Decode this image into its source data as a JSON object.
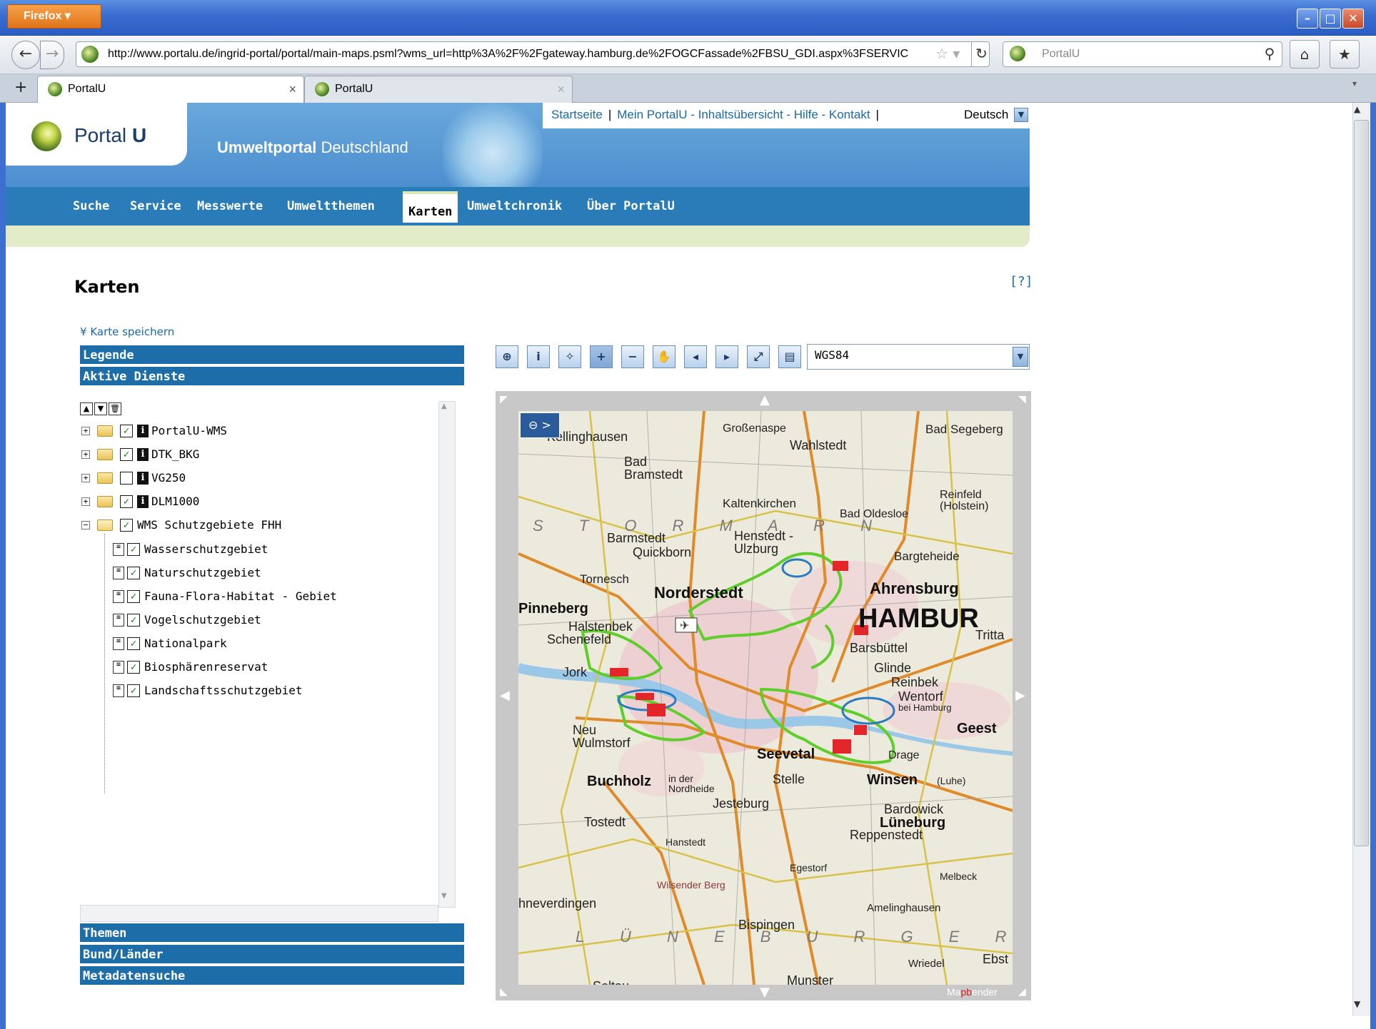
{
  "browser": {
    "menu_button": "Firefox",
    "url": "http://www.portalu.de/ingrid-portal/portal/main-maps.psml?wms_url=http%3A%2F%2Fgateway.hamburg.de%2FOGCFassade%2FBSU_GDI.aspx%3FSERVIC",
    "search_placeholder": "PortalU",
    "tabs": [
      {
        "label": "PortalU",
        "active": true
      },
      {
        "label": "PortalU",
        "active": false
      }
    ]
  },
  "header": {
    "logo_text_light": "Portal",
    "logo_text_bold": "U",
    "tagline_bold": "Umweltportal",
    "tagline_light": "Deutschland",
    "top_links": [
      "Startseite",
      "Mein PortalU - Inhaltsübersicht - Hilfe - Kontakt"
    ],
    "language": "Deutsch"
  },
  "mainnav": {
    "items": [
      "Suche",
      "Service",
      "Messwerte",
      "Umweltthemen",
      "Karten",
      "Umweltchronik",
      "Über PortalU"
    ],
    "active": "Karten"
  },
  "page": {
    "title": "Karten",
    "help": "[?]",
    "save_link": "Karte speichern"
  },
  "sidebar": {
    "legende": "Legende",
    "aktive_dienste": "Aktive Dienste",
    "themen": "Themen",
    "bund_laender": "Bund/Länder",
    "metadatensuche": "Metadatensuche",
    "services": [
      {
        "label": "PortalU-WMS",
        "checked": true
      },
      {
        "label": "DTK_BKG",
        "checked": true
      },
      {
        "label": "VG250",
        "checked": false
      },
      {
        "label": "DLM1000",
        "checked": true
      },
      {
        "label": "WMS Schutzgebiete FHH",
        "checked": true
      }
    ],
    "layers": [
      "Wasserschutzgebiet",
      "Naturschutzgebiet",
      "Fauna-Flora-Habitat - Gebiet",
      "Vogelschutzgebiet",
      "Nationalpark",
      "Biosphärenreservat",
      "Landschaftsschutzgebiet"
    ]
  },
  "map": {
    "srs": "WGS84",
    "credit_a": "Ma",
    "credit_b": "pb",
    "credit_c": "ender",
    "places": {
      "kellinghausen": "Kellinghausen",
      "grossenaspe": "Großenaspe",
      "bad_segeberg": "Bad Segeberg",
      "wahlstedt": "Wahlstedt",
      "bad_bramstedt": "Bad Bramstedt",
      "kaltenkirchen": "Kaltenkirchen",
      "bad_oldesloe": "Bad Oldesloe",
      "reinfeld": "Reinfeld (Holstein)",
      "barmstedt": "Barmstedt",
      "quickborn": "Quickborn",
      "henstedt": "Henstedt -Ulzburg",
      "bargteheide": "Bargteheide",
      "tornesch": "Tornesch",
      "norderstedt": "Norderstedt",
      "ahrensburg": "Ahrensburg",
      "pinneberg": "Pinneberg",
      "hamburg": "HAMBUR",
      "halstenbek": "Halstenbek",
      "schenefeld": "Schenefeld",
      "barsbuettel": "Barsbüttel",
      "trittau": "Tritta",
      "jork": "Jork",
      "glinde": "Glinde",
      "reinbek": "Reinbek",
      "wentorf": "Wentorf",
      "bei_hamburg": "bei Hamburg",
      "neu_wulmstorf": "Neu Wulmstorf",
      "geest": "Geest",
      "seevetal": "Seevetal",
      "drage": "Drage",
      "buchholz": "Buchholz",
      "buchholz_sub": "in der Nordheide",
      "stelle": "Stelle",
      "winsen": "Winsen",
      "winsen_sub": "(Luhe)",
      "jesteburg": "Jesteburg",
      "bardowick": "Bardowick",
      "tostedt": "Tostedt",
      "lueneburg": "Lüneburg",
      "hanstedt": "Hanstedt",
      "reppenstedt": "Reppenstedt",
      "egestorf": "Egestorf",
      "wilsender_berg": "Wilsender Berg",
      "melbeck": "Melbeck",
      "schneverdingen": "hneverdingen",
      "amelinghausen": "Amelinghausen",
      "bispingen": "Bispingen",
      "ebstorf": "Ebst",
      "wriedel": "Wriedel",
      "munster": "Munster",
      "soltau": "Soltau",
      "region_storman": "S T O R M A R N",
      "region_lueneburger": "L Ü N E B U R G E R"
    }
  }
}
